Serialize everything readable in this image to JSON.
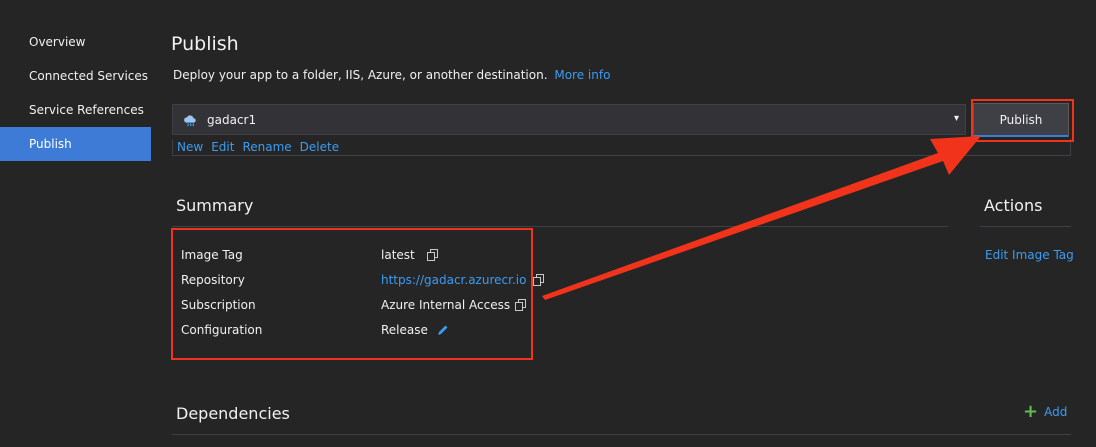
{
  "sidebar": {
    "items": [
      {
        "label": "Overview"
      },
      {
        "label": "Connected Services"
      },
      {
        "label": "Service References"
      },
      {
        "label": "Publish"
      }
    ]
  },
  "header": {
    "title": "Publish",
    "subtitle": "Deploy your app to a folder, IIS, Azure, or another destination.",
    "more_info": "More info"
  },
  "profile": {
    "selected": "gadacr1",
    "icon": "cloud-icon",
    "actions": [
      "New",
      "Edit",
      "Rename",
      "Delete"
    ]
  },
  "publish_button": "Publish",
  "summary": {
    "title": "Summary",
    "rows": [
      {
        "label": "Image Tag",
        "value": "latest"
      },
      {
        "label": "Repository",
        "value": "https://gadacr.azurecr.io"
      },
      {
        "label": "Subscription",
        "value": "Azure Internal Access"
      },
      {
        "label": "Configuration",
        "value": "Release"
      }
    ]
  },
  "actions": {
    "title": "Actions",
    "edit_image_tag": "Edit Image Tag"
  },
  "dependencies": {
    "title": "Dependencies",
    "add": "Add"
  },
  "colors": {
    "accent": "#3e7bd6",
    "link": "#3b9cf2",
    "highlight": "#f0331a"
  }
}
